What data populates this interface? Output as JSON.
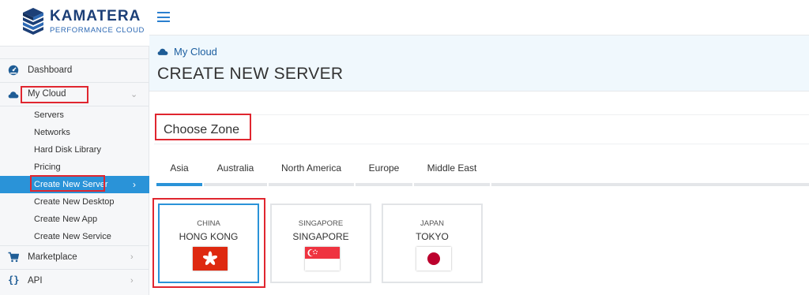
{
  "brand": {
    "name": "KAMATERA",
    "tagline": "PERFORMANCE CLOUD"
  },
  "sidebar": {
    "items": [
      {
        "label": "Dashboard",
        "icon": "dashboard-icon"
      },
      {
        "label": "My Cloud",
        "icon": "cloud-icon",
        "expanded": true
      },
      {
        "label": "Marketplace",
        "icon": "cart-icon"
      },
      {
        "label": "API",
        "icon": "braces-icon"
      }
    ],
    "subitems": [
      {
        "label": "Servers"
      },
      {
        "label": "Networks"
      },
      {
        "label": "Hard Disk Library"
      },
      {
        "label": "Pricing"
      },
      {
        "label": "Create New Server",
        "active": true
      },
      {
        "label": "Create New Desktop"
      },
      {
        "label": "Create New App"
      },
      {
        "label": "Create New Service"
      }
    ]
  },
  "header": {
    "breadcrumb": "My Cloud",
    "title": "CREATE NEW SERVER"
  },
  "zone": {
    "heading": "Choose Zone",
    "tabs": [
      {
        "label": "Asia",
        "active": true
      },
      {
        "label": "Australia"
      },
      {
        "label": "North America"
      },
      {
        "label": "Europe"
      },
      {
        "label": "Middle East"
      }
    ],
    "cards": [
      {
        "country": "CHINA",
        "city": "HONG KONG",
        "flag": "hong-kong-flag",
        "selected": true
      },
      {
        "country": "SINGAPORE",
        "city": "SINGAPORE",
        "flag": "singapore-flag"
      },
      {
        "country": "JAPAN",
        "city": "TOKYO",
        "flag": "japan-flag"
      }
    ]
  },
  "colors": {
    "accent": "#2a93d8",
    "brand": "#1c3f77",
    "highlight": "#e0262f"
  }
}
